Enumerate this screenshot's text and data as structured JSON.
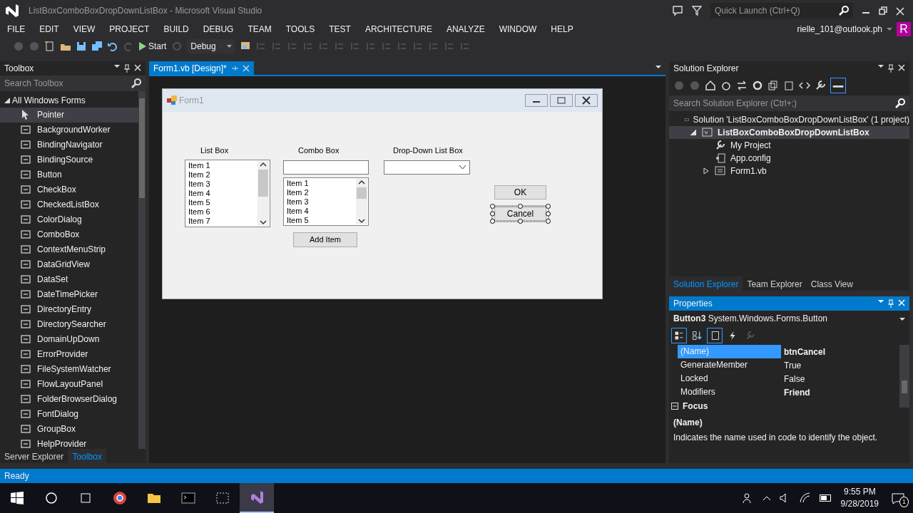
{
  "window": {
    "title": "ListBoxComboBoxDropDownListBox - Microsoft Visual Studio"
  },
  "quick_launch": {
    "placeholder": "Quick Launch (Ctrl+Q)"
  },
  "menu": [
    "FILE",
    "EDIT",
    "VIEW",
    "PROJECT",
    "BUILD",
    "DEBUG",
    "TEAM",
    "TOOLS",
    "TEST",
    "ARCHITECTURE",
    "ANALYZE",
    "WINDOW",
    "HELP"
  ],
  "account": {
    "email": "rielle_101@outlook.ph",
    "avatar": "R"
  },
  "toolbar": {
    "start": "Start",
    "configuration": "Debug"
  },
  "toolbox": {
    "title": "Toolbox",
    "search": {
      "placeholder": "Search Toolbox"
    },
    "group": {
      "label": "All Windows Forms",
      "expanded": true
    },
    "items": [
      {
        "label": "Pointer",
        "selected": true
      },
      {
        "label": "BackgroundWorker",
        "selected": false
      },
      {
        "label": "BindingNavigator",
        "selected": false
      },
      {
        "label": "BindingSource",
        "selected": false
      },
      {
        "label": "Button",
        "selected": false
      },
      {
        "label": "CheckBox",
        "selected": false
      },
      {
        "label": "CheckedListBox",
        "selected": false
      },
      {
        "label": "ColorDialog",
        "selected": false
      },
      {
        "label": "ComboBox",
        "selected": false
      },
      {
        "label": "ContextMenuStrip",
        "selected": false
      },
      {
        "label": "DataGridView",
        "selected": false
      },
      {
        "label": "DataSet",
        "selected": false
      },
      {
        "label": "DateTimePicker",
        "selected": false
      },
      {
        "label": "DirectoryEntry",
        "selected": false
      },
      {
        "label": "DirectorySearcher",
        "selected": false
      },
      {
        "label": "DomainUpDown",
        "selected": false
      },
      {
        "label": "ErrorProvider",
        "selected": false
      },
      {
        "label": "FileSystemWatcher",
        "selected": false
      },
      {
        "label": "FlowLayoutPanel",
        "selected": false
      },
      {
        "label": "FolderBrowserDialog",
        "selected": false
      },
      {
        "label": "FontDialog",
        "selected": false
      },
      {
        "label": "GroupBox",
        "selected": false
      },
      {
        "label": "HelpProvider",
        "selected": false
      }
    ],
    "tabs": [
      {
        "label": "Server Explorer",
        "selected": false
      },
      {
        "label": "Toolbox",
        "selected": true
      }
    ]
  },
  "document_tabs": [
    {
      "label": "Form1.vb [Design]*",
      "selected": true
    }
  ],
  "form": {
    "title": "Form1",
    "labels": [
      "List Box",
      "Combo Box",
      "Drop-Down List Box"
    ],
    "list_box": [
      "Item 1",
      "Item 2",
      "Item 3",
      "Item 4",
      "Item 5",
      "Item 6",
      "Item 7"
    ],
    "combo_box": [
      "Item 1",
      "Item 2",
      "Item 3",
      "Item 4",
      "Item 5"
    ],
    "add_button": "Add Item",
    "buttons": [
      {
        "label": "OK",
        "selected": false
      },
      {
        "label": "Cancel",
        "selected": true
      }
    ]
  },
  "solution_explorer": {
    "title": "Solution Explorer",
    "search": {
      "placeholder": "Search Solution Explorer (Ctrl+;)"
    },
    "tree": [
      {
        "label": "Solution 'ListBoxComboBoxDropDownListBox' (1 project)",
        "kind": "solution",
        "selected": false,
        "children": [
          {
            "label": "ListBoxComboBoxDropDownListBox",
            "kind": "project",
            "selected": true,
            "expanded": true,
            "children": [
              {
                "label": "My Project",
                "kind": "settings",
                "selected": false
              },
              {
                "label": "App.config",
                "kind": "config",
                "selected": false
              },
              {
                "label": "Form1.vb",
                "kind": "form",
                "selected": false,
                "expanded": false
              }
            ]
          }
        ]
      }
    ],
    "tabs": [
      {
        "label": "Solution Explorer",
        "selected": true
      },
      {
        "label": "Team Explorer",
        "selected": false
      },
      {
        "label": "Class View",
        "selected": false
      }
    ]
  },
  "properties": {
    "title": "Properties",
    "object": {
      "name": "Button3",
      "type": "System.Windows.Forms.Button"
    },
    "toolbar": [
      {
        "kind": "categorized",
        "selected": true
      },
      {
        "kind": "alphabetical",
        "selected": false
      },
      {
        "kind": "properties",
        "selected": true
      },
      {
        "kind": "events",
        "selected": false
      },
      {
        "kind": "pages",
        "selected": false
      }
    ],
    "rows": [
      {
        "name": "(Name)",
        "value": "btnCancel",
        "modified": true,
        "selected": true
      },
      {
        "name": "GenerateMember",
        "value": "True",
        "modified": false,
        "selected": false
      },
      {
        "name": "Locked",
        "value": "False",
        "modified": false,
        "selected": false
      },
      {
        "name": "Modifiers",
        "value": "Friend",
        "modified": true,
        "selected": false
      }
    ],
    "category": {
      "label": "Focus",
      "expanded": true
    },
    "description": {
      "title": "(Name)",
      "text": "Indicates the name used in code to identify the object."
    }
  },
  "status_bar": {
    "text": "Ready"
  },
  "taskbar": {
    "apps": [
      {
        "kind": "browser",
        "active": false
      },
      {
        "kind": "folder",
        "active": false
      },
      {
        "kind": "terminal",
        "active": false
      },
      {
        "kind": "snip",
        "active": false
      },
      {
        "kind": "studio",
        "active": true
      }
    ],
    "time": "9:55 PM",
    "date": "9/28/2019",
    "notifications": "1"
  }
}
